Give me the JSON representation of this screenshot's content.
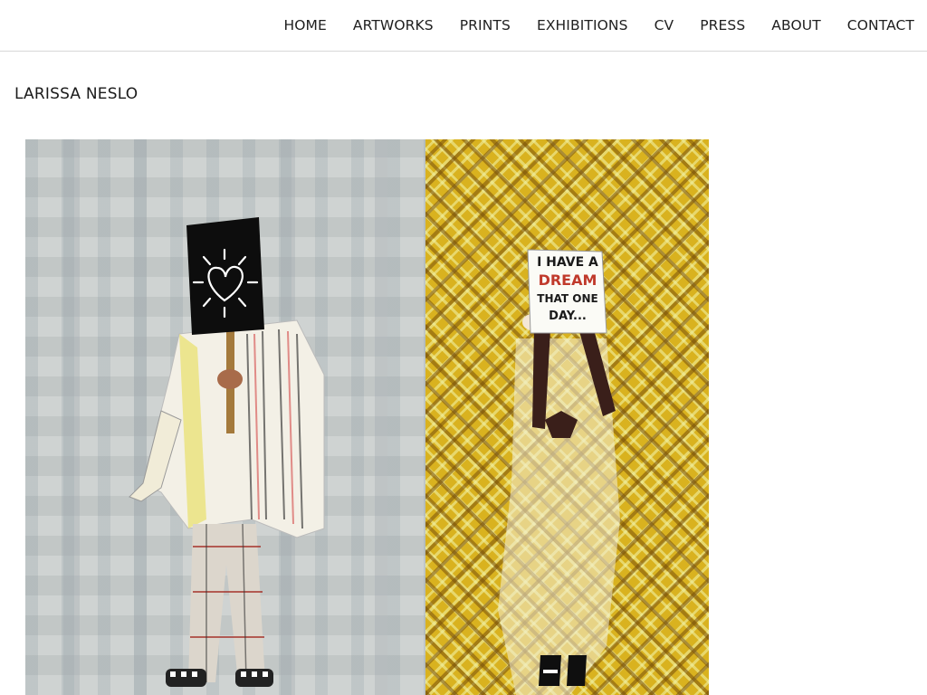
{
  "nav": {
    "items": [
      {
        "label": "HOME"
      },
      {
        "label": "ARTWORKS"
      },
      {
        "label": "PRINTS"
      },
      {
        "label": "EXHIBITIONS"
      },
      {
        "label": "CV"
      },
      {
        "label": "PRESS"
      },
      {
        "label": "ABOUT"
      },
      {
        "label": "CONTACT"
      }
    ]
  },
  "page": {
    "artist_name": "LARISSA NESLO"
  },
  "artwork": {
    "sign_left_icon": "heart-doodle-icon",
    "sign_right_text": [
      "I HAVE A",
      "DREAM",
      "THAT ONE",
      "DAY..."
    ],
    "colors": {
      "left_background": "#c9cdcc",
      "right_background": "#d9b21f",
      "sign_black": "#0d0d0d"
    }
  }
}
